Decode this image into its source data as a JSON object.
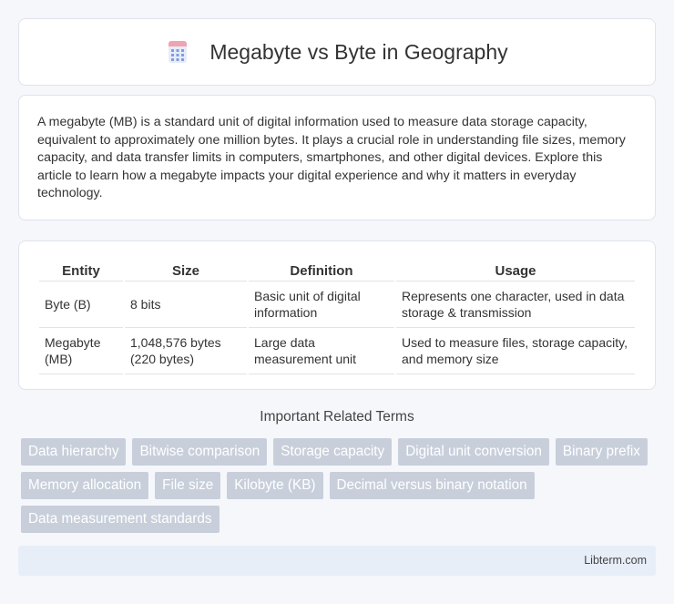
{
  "header": {
    "title": "Megabyte vs Byte in Geography",
    "icon": "calculator-icon"
  },
  "intro": {
    "text": "A megabyte (MB) is a standard unit of digital information used to measure data storage capacity, equivalent to approximately one million bytes. It plays a crucial role in understanding file sizes, memory capacity, and data transfer limits in computers, smartphones, and other digital devices. Explore this article to learn how a megabyte impacts your digital experience and why it matters in everyday technology."
  },
  "table": {
    "headers": [
      "Entity",
      "Size",
      "Definition",
      "Usage"
    ],
    "rows": [
      [
        "Byte (B)",
        "8 bits",
        "Basic unit of digital information",
        "Represents one character, used in data storage & transmission"
      ],
      [
        "Megabyte (MB)",
        "1,048,576 bytes (220 bytes)",
        "Large data measurement unit",
        "Used to measure files, storage capacity, and memory size"
      ]
    ]
  },
  "related": {
    "title": "Important Related Terms",
    "tags": [
      "Data hierarchy",
      "Bitwise comparison",
      "Storage capacity",
      "Digital unit conversion",
      "Binary prefix",
      "Memory allocation",
      "File size",
      "Kilobyte (KB)",
      "Decimal versus binary notation",
      "Data measurement standards"
    ]
  },
  "footer": {
    "text": "Libterm.com"
  },
  "colors": {
    "background": "#f5f7fb",
    "tag_bg": "#c8cfdb",
    "footer_bg": "#e8eef7",
    "icon_accent": "#5b7fd6"
  }
}
